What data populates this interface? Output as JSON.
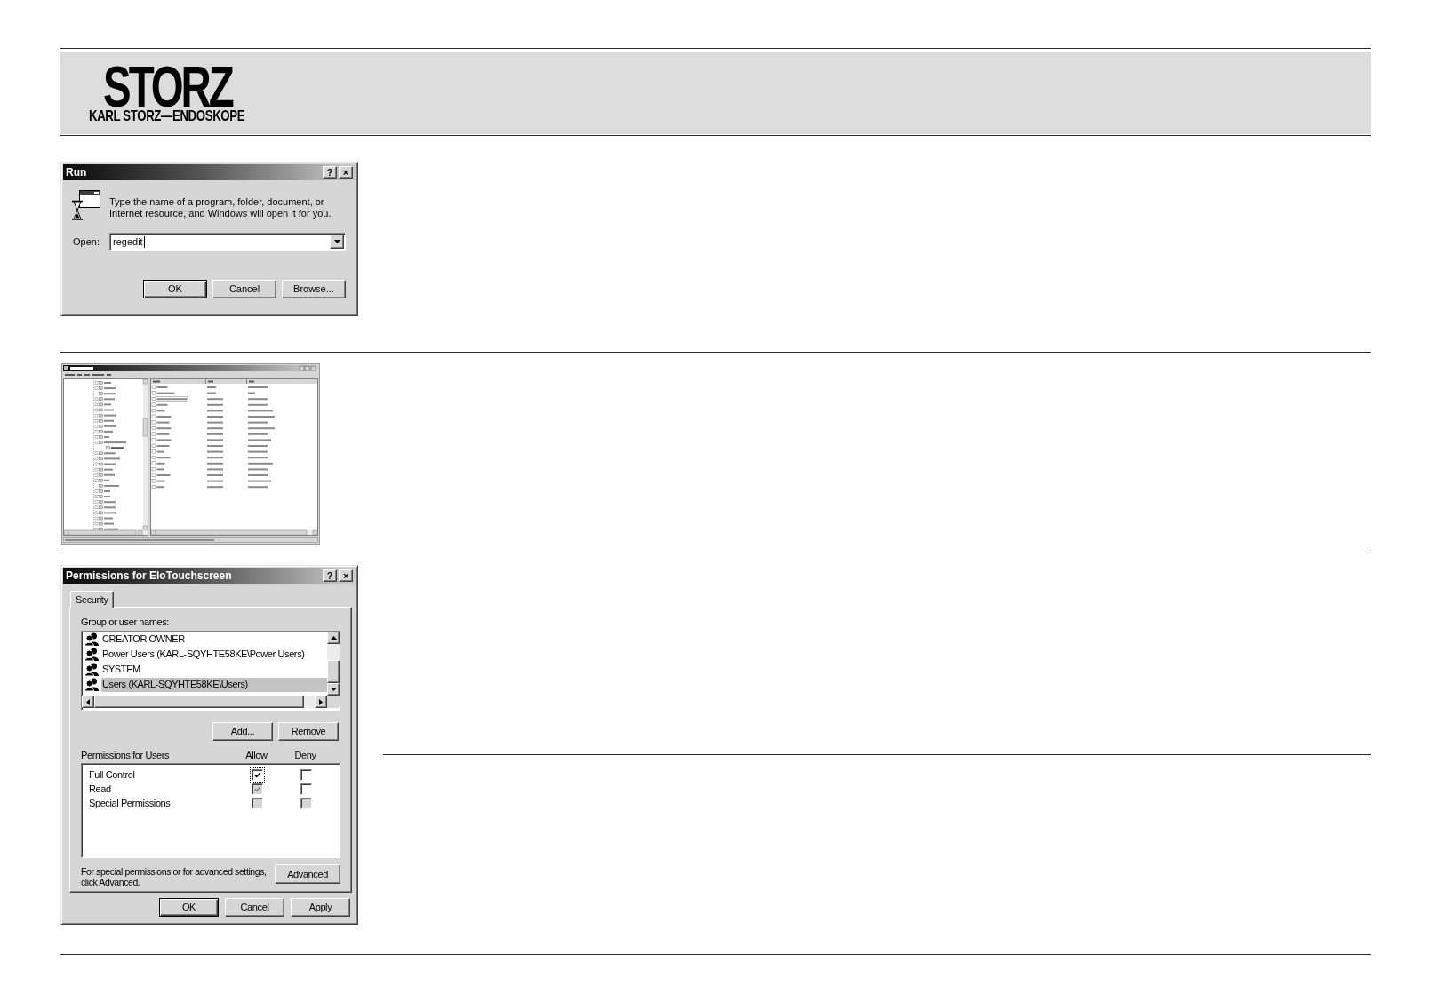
{
  "header": {
    "logo_wordmark": "STORZ",
    "logo_tagline": "KARL STORZ—ENDOSKOPE"
  },
  "run_dialog": {
    "title": "Run",
    "title_buttons": [
      "?",
      "×"
    ],
    "message": "Type the name of a program, folder, document, or Internet resource, and Windows will open it for you.",
    "open_field": {
      "label": "Open:",
      "value": "regedit"
    },
    "buttons": [
      {
        "label": "OK",
        "default": true
      },
      {
        "label": "Cancel",
        "default": false
      },
      {
        "label": "Browse...",
        "default": false
      }
    ]
  },
  "permissions_dialog": {
    "title": "Permissions for EloTouchscreen",
    "title_buttons": [
      "?",
      "×"
    ],
    "tabs": [
      {
        "label": "Security",
        "selected": true
      }
    ],
    "group_list": {
      "label": "Group or user names:",
      "items": [
        {
          "name": "CREATOR OWNER",
          "selected": false
        },
        {
          "name": "Power Users (KARL-SQYHTE58KE\\Power Users)",
          "selected": false
        },
        {
          "name": "SYSTEM",
          "selected": false
        },
        {
          "name": "Users (KARL-SQYHTE58KE\\Users)",
          "selected": true
        }
      ]
    },
    "list_buttons": [
      {
        "label": "Add..."
      },
      {
        "label": "Remove"
      }
    ],
    "permissions": {
      "label": "Permissions for Users",
      "columns": [
        "Allow",
        "Deny"
      ],
      "rows": [
        {
          "name": "Full Control",
          "allow": {
            "checked": true,
            "disabled": false,
            "focused": true
          },
          "deny": {
            "checked": false,
            "disabled": false,
            "focused": false
          }
        },
        {
          "name": "Read",
          "allow": {
            "checked": true,
            "disabled": true,
            "focused": false
          },
          "deny": {
            "checked": false,
            "disabled": false,
            "focused": false
          }
        },
        {
          "name": "Special Permissions",
          "allow": {
            "checked": false,
            "disabled": true,
            "focused": false
          },
          "deny": {
            "checked": false,
            "disabled": true,
            "focused": false
          }
        }
      ]
    },
    "advanced_note": "For special permissions or for advanced settings, click Advanced.",
    "advanced_button": {
      "label": "Advanced"
    },
    "buttons": [
      {
        "label": "OK",
        "default": true
      },
      {
        "label": "Cancel",
        "default": false
      },
      {
        "label": "Apply",
        "default": false
      }
    ]
  }
}
